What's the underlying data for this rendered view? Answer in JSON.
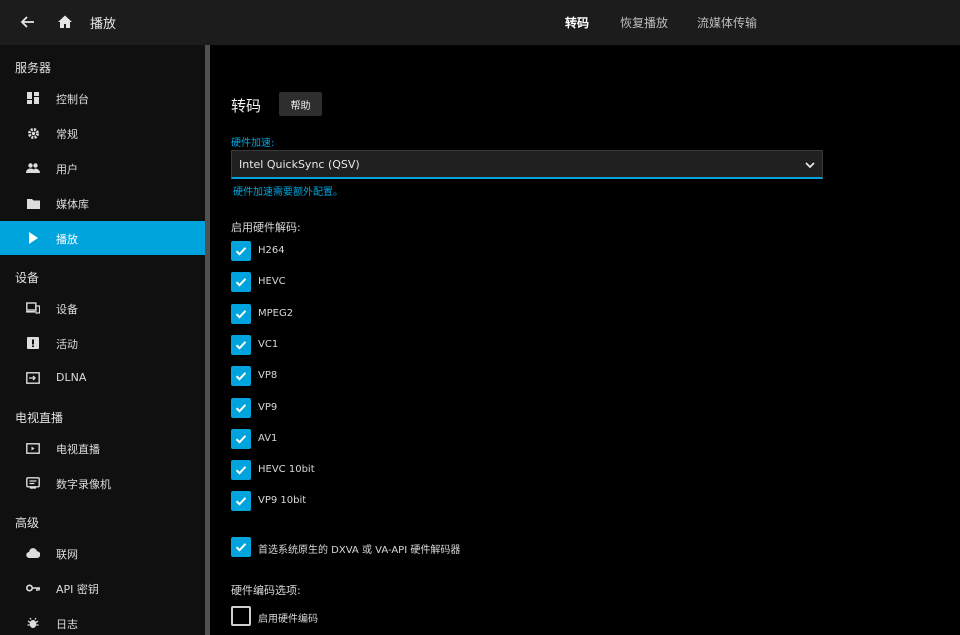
{
  "header": {
    "title": "播放",
    "tabs": [
      {
        "label": "转码",
        "active": true
      },
      {
        "label": "恢复播放",
        "active": false
      },
      {
        "label": "流媒体传输",
        "active": false
      }
    ]
  },
  "sidebar": {
    "sections": [
      {
        "title": "服务器"
      },
      {
        "title": "设备"
      },
      {
        "title": "电视直播"
      },
      {
        "title": "高级"
      }
    ],
    "items": [
      {
        "label": "控制台",
        "icon": "dashboard-icon"
      },
      {
        "label": "常规",
        "icon": "gear-icon"
      },
      {
        "label": "用户",
        "icon": "users-icon"
      },
      {
        "label": "媒体库",
        "icon": "folder-icon"
      },
      {
        "label": "播放",
        "icon": "play-icon",
        "active": true
      },
      {
        "label": "设备",
        "icon": "devices-icon"
      },
      {
        "label": "活动",
        "icon": "activity-icon"
      },
      {
        "label": "DLNA",
        "icon": "dlna-icon"
      },
      {
        "label": "电视直播",
        "icon": "tv-icon"
      },
      {
        "label": "数字录像机",
        "icon": "dvr-icon"
      },
      {
        "label": "联网",
        "icon": "cloud-icon"
      },
      {
        "label": "API 密钥",
        "icon": "key-icon"
      },
      {
        "label": "日志",
        "icon": "bug-icon"
      }
    ]
  },
  "main": {
    "title": "转码",
    "help_label": "帮助",
    "hw_accel": {
      "label": "硬件加速:",
      "value": "Intel QuickSync (QSV)",
      "hint": "硬件加速需要额外配置。"
    },
    "decoding": {
      "label": "启用硬件解码:",
      "codecs": [
        {
          "label": "H264",
          "checked": true
        },
        {
          "label": "HEVC",
          "checked": true
        },
        {
          "label": "MPEG2",
          "checked": true
        },
        {
          "label": "VC1",
          "checked": true
        },
        {
          "label": "VP8",
          "checked": true
        },
        {
          "label": "VP9",
          "checked": true
        },
        {
          "label": "AV1",
          "checked": true
        },
        {
          "label": "HEVC 10bit",
          "checked": true
        },
        {
          "label": "VP9 10bit",
          "checked": true
        }
      ]
    },
    "prefer_native": {
      "label": "首选系统原生的 DXVA 或 VA-API 硬件解码器",
      "checked": true
    },
    "encoding": {
      "label": "硬件编码选项:",
      "enable": {
        "label": "启用硬件编码",
        "checked": false
      }
    }
  },
  "colors": {
    "accent": "#00a4dc",
    "header_bg": "#1c1c1c",
    "sidebar_bg": "#101010",
    "main_bg": "#000000"
  }
}
